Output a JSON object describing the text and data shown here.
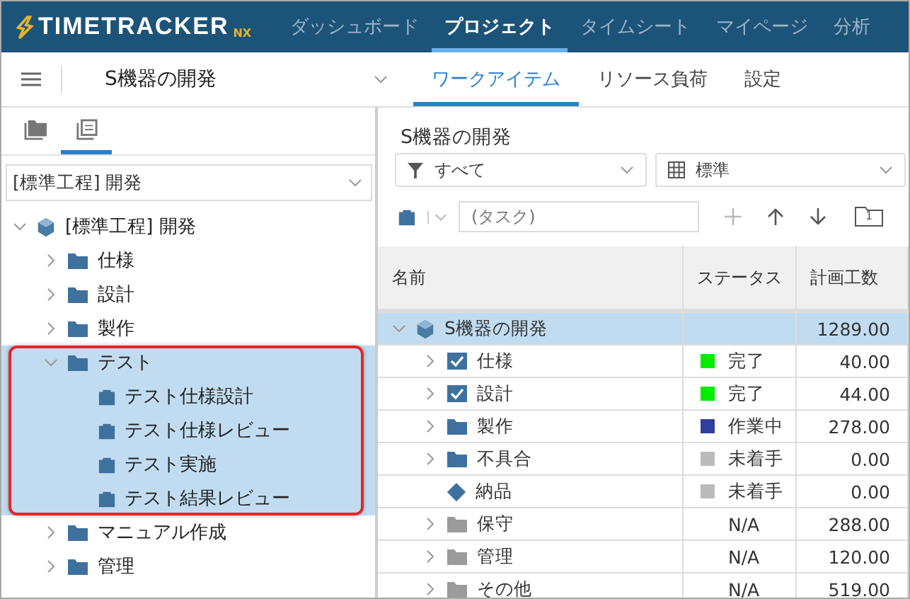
{
  "header": {
    "logo": "TIMETRACKER",
    "logo_suffix": "NX",
    "nav": [
      {
        "label": "ダッシュボード",
        "selected": false
      },
      {
        "label": "プロジェクト",
        "selected": true
      },
      {
        "label": "タイムシート",
        "selected": false
      },
      {
        "label": "マイページ",
        "selected": false
      },
      {
        "label": "分析",
        "selected": false
      }
    ]
  },
  "subbar": {
    "project": "S機器の開発",
    "tabs": [
      {
        "label": "ワークアイテム",
        "selected": true
      },
      {
        "label": "リソース負荷",
        "selected": false
      },
      {
        "label": "設定",
        "selected": false
      }
    ]
  },
  "sidebar": {
    "view_tabs": [
      {
        "kind": "folders",
        "selected": false
      },
      {
        "kind": "templates",
        "selected": true
      }
    ],
    "template": "[標準工程] 開発",
    "tree": [
      {
        "label": "[標準工程] 開発",
        "kind": "project",
        "expanded": true,
        "selected": false,
        "children": [
          {
            "label": "仕様",
            "kind": "folder",
            "expanded": false,
            "selected": false
          },
          {
            "label": "設計",
            "kind": "folder",
            "expanded": false,
            "selected": false
          },
          {
            "label": "製作",
            "kind": "folder",
            "expanded": false,
            "selected": false
          },
          {
            "label": "テスト",
            "kind": "folder",
            "expanded": true,
            "selected": true,
            "highlighted": true,
            "children": [
              {
                "label": "テスト仕様設計",
                "kind": "task",
                "selected": true
              },
              {
                "label": "テスト仕様レビュー",
                "kind": "task",
                "selected": true
              },
              {
                "label": "テスト実施",
                "kind": "task",
                "selected": true
              },
              {
                "label": "テスト結果レビュー",
                "kind": "task",
                "selected": true
              }
            ]
          },
          {
            "label": "マニュアル作成",
            "kind": "folder",
            "expanded": false,
            "selected": false
          },
          {
            "label": "管理",
            "kind": "folder",
            "expanded": false,
            "selected": false
          }
        ]
      }
    ]
  },
  "main": {
    "title": "S機器の開発",
    "filter": "すべて",
    "view": "標準",
    "new_item_placeholder": "(タスク)",
    "page_badge": "1",
    "table": {
      "columns": [
        "名前",
        "ステータス",
        "計画工数"
      ],
      "rows": [
        {
          "name": "S機器の開発",
          "kind": "project",
          "expanded": true,
          "selected": true,
          "planned": "1289.00",
          "children": [
            {
              "name": "仕様",
              "kind": "checked",
              "expanded": false,
              "selected": false,
              "status": "完了",
              "color": "#00ee00",
              "planned": "40.00"
            },
            {
              "name": "設計",
              "kind": "checked",
              "expanded": false,
              "selected": false,
              "status": "完了",
              "color": "#00ee00",
              "planned": "44.00"
            },
            {
              "name": "製作",
              "kind": "folder",
              "expanded": false,
              "selected": false,
              "status": "作業中",
              "color": "#2e3f9e",
              "planned": "278.00"
            },
            {
              "name": "不具合",
              "kind": "folder",
              "expanded": false,
              "selected": false,
              "status": "未着手",
              "color": "#bbbbbb",
              "planned": "0.00"
            },
            {
              "name": "納品",
              "kind": "milestone",
              "selected": false,
              "status": "未着手",
              "color": "#bbbbbb",
              "planned": "0.00"
            },
            {
              "name": "保守",
              "kind": "inactive-folder",
              "expanded": false,
              "selected": false,
              "status": "N/A",
              "planned": "288.00"
            },
            {
              "name": "管理",
              "kind": "inactive-folder",
              "expanded": false,
              "selected": false,
              "status": "N/A",
              "planned": "120.00"
            },
            {
              "name": "その他",
              "kind": "inactive-folder",
              "expanded": false,
              "selected": false,
              "status": "N/A",
              "planned": "519.00"
            }
          ]
        }
      ]
    }
  }
}
